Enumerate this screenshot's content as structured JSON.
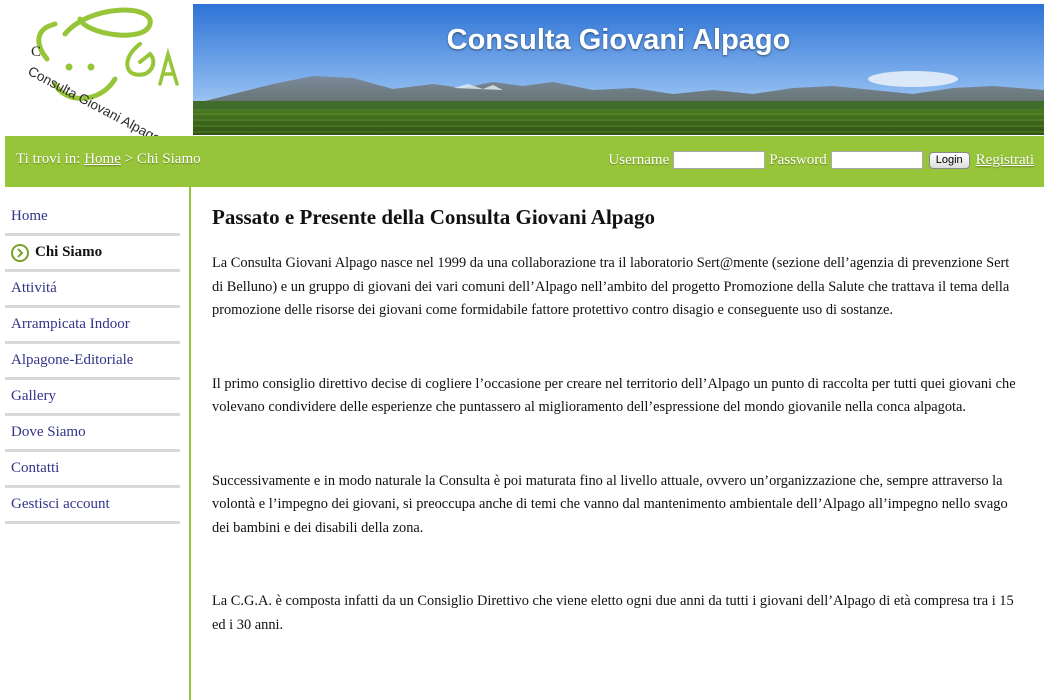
{
  "site": {
    "title": "Consulta Giovani Alpago",
    "logo_text": "Consulta Giovani Alpago",
    "logo_letters": "CGA"
  },
  "breadcrumb": {
    "prefix": "Ti trovi in:",
    "home": "Home",
    "separator": ">",
    "current": "Chi Siamo"
  },
  "login": {
    "username_label": "Username",
    "password_label": "Password",
    "username_value": "",
    "password_value": "",
    "login_button": "Login",
    "register_link": "Registrati"
  },
  "sidebar": {
    "items": [
      {
        "label": "Home",
        "active": false
      },
      {
        "label": "Chi Siamo",
        "active": true
      },
      {
        "label": "Attivitá",
        "active": false
      },
      {
        "label": "Arrampicata Indoor",
        "active": false
      },
      {
        "label": "Alpagone-Editoriale",
        "active": false
      },
      {
        "label": "Gallery",
        "active": false
      },
      {
        "label": "Dove Siamo",
        "active": false
      },
      {
        "label": "Contatti",
        "active": false
      },
      {
        "label": "Gestisci account",
        "active": false
      }
    ]
  },
  "content": {
    "heading": "Passato e Presente della Consulta Giovani Alpago",
    "paragraphs": [
      "La Consulta Giovani Alpago nasce nel 1999 da una collaborazione tra il laboratorio Sert@mente (sezione dell’agenzia di prevenzione Sert di Belluno) e un gruppo di giovani dei vari comuni dell’Alpago nell’ambito del progetto Promozione della Salute che trattava il tema della promozione delle risorse dei giovani come formidabile fattore protettivo contro disagio e conseguente uso di sostanze.",
      "Il primo consiglio direttivo decise di cogliere l’occasione per creare nel territorio dell’Alpago un punto di raccolta per tutti quei giovani che volevano condividere delle esperienze che puntassero al miglioramento dell’espressione del mondo giovanile nella conca alpagota.",
      "Successivamente e in modo naturale la Consulta è poi maturata fino al livello attuale, ovvero un’organizzazione che, sempre attraverso la volontà e l’impegno dei giovani, si preoccupa anche di temi che vanno dal mantenimento ambientale dell’Alpago all’impegno nello svago dei bambini e dei disabili della zona.",
      "La C.G.A. è composta infatti da un Consiglio Direttivo che viene eletto ogni due anni da tutti i giovani dell’Alpago di età compresa tra i 15 ed i 30 anni."
    ]
  },
  "colors": {
    "accent_green": "#97c53a",
    "link_blue": "#33338a"
  },
  "icons": {
    "active_marker": "chevron-right-circle-icon"
  }
}
